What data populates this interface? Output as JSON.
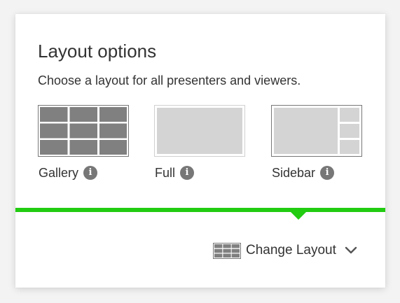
{
  "panel": {
    "title": "Layout options",
    "subtitle": "Choose a layout for all presenters and viewers."
  },
  "layouts": [
    {
      "label": "Gallery",
      "icon": "gallery-layout-icon",
      "info_icon": "i"
    },
    {
      "label": "Full",
      "icon": "full-layout-icon",
      "info_icon": "i"
    },
    {
      "label": "Sidebar",
      "icon": "sidebar-layout-icon",
      "info_icon": "i"
    }
  ],
  "footer": {
    "change_layout_label": "Change Layout",
    "change_layout_icon": "grid-layout-icon",
    "dropdown_icon": "chevron-down-icon"
  },
  "colors": {
    "accent_green": "#22cc11",
    "selected_tile": "#808080",
    "unselected_tile": "#d4d4d4",
    "text": "#333333"
  }
}
